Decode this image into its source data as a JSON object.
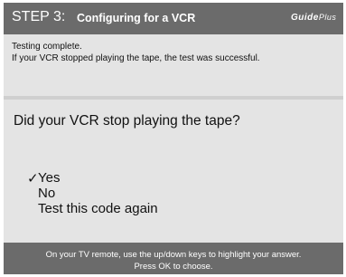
{
  "header": {
    "step_number": "STEP 3:",
    "step_title": "Configuring for a VCR",
    "logo": "Guide",
    "logo_tail": "Plus"
  },
  "status": {
    "line1": "Testing complete.",
    "line2": "If your VCR stopped playing the tape, the test was successful."
  },
  "question": "Did your VCR stop playing the tape?",
  "options": [
    {
      "label": "Yes",
      "selected": true
    },
    {
      "label": "No",
      "selected": false
    },
    {
      "label": "Test this code again",
      "selected": false
    }
  ],
  "check_mark": "✓",
  "footer": {
    "line1": "On your TV remote, use the up/down keys to highlight your answer.",
    "line2": "Press OK to choose."
  },
  "colors": {
    "bar": "#6b6b6b",
    "panel": "#e4e4e4",
    "text": "#111111"
  }
}
